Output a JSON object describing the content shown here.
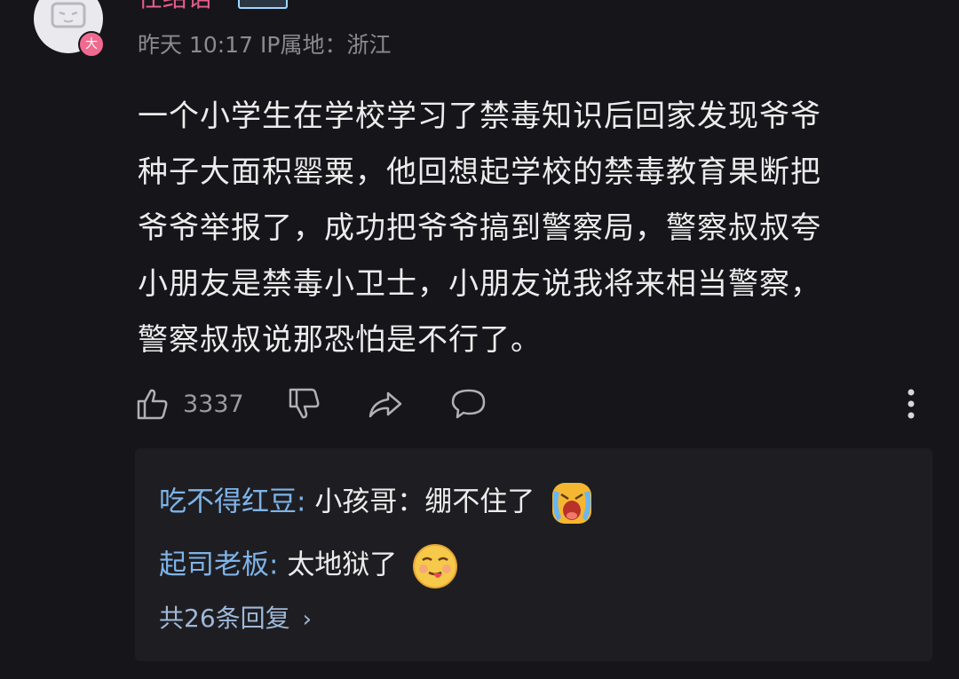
{
  "comment": {
    "username": "任结语",
    "level_badge": "大",
    "meta": {
      "time": "昨天 10:17",
      "ip_location": "IP属地：浙江"
    },
    "lines": [
      "一个小学生在学校学习了禁毒知识后回家发现爷爷",
      "种子大面积罂粟，他回想起学校的禁毒教育果断把",
      "爷爷举报了，成功把爷爷搞到警察局，警察叔叔夸",
      "小朋友是禁毒小卫士，小朋友说我将来相当警察，",
      "警察叔叔说那恐怕是不行了。"
    ],
    "like_count": "3337"
  },
  "icons": {
    "like": "thumbs-up-icon",
    "dislike": "thumbs-down-icon",
    "share": "share-icon",
    "reply": "comment-icon",
    "more": "more-vertical-icon"
  },
  "replies": [
    {
      "name": "吃不得红豆:",
      "text": "小孩哥：绷不住了",
      "emoji": "crying-emoji"
    },
    {
      "name": "起司老板:",
      "text": "太地狱了",
      "emoji": "tongue-out-emoji"
    }
  ],
  "replies_more": {
    "label": "共26条回复",
    "chevron": "›"
  },
  "colors": {
    "background": "#16161a",
    "username": "#e55e8a",
    "reply_name": "#7fb3e8",
    "reply_panel": "#1e1e22"
  }
}
